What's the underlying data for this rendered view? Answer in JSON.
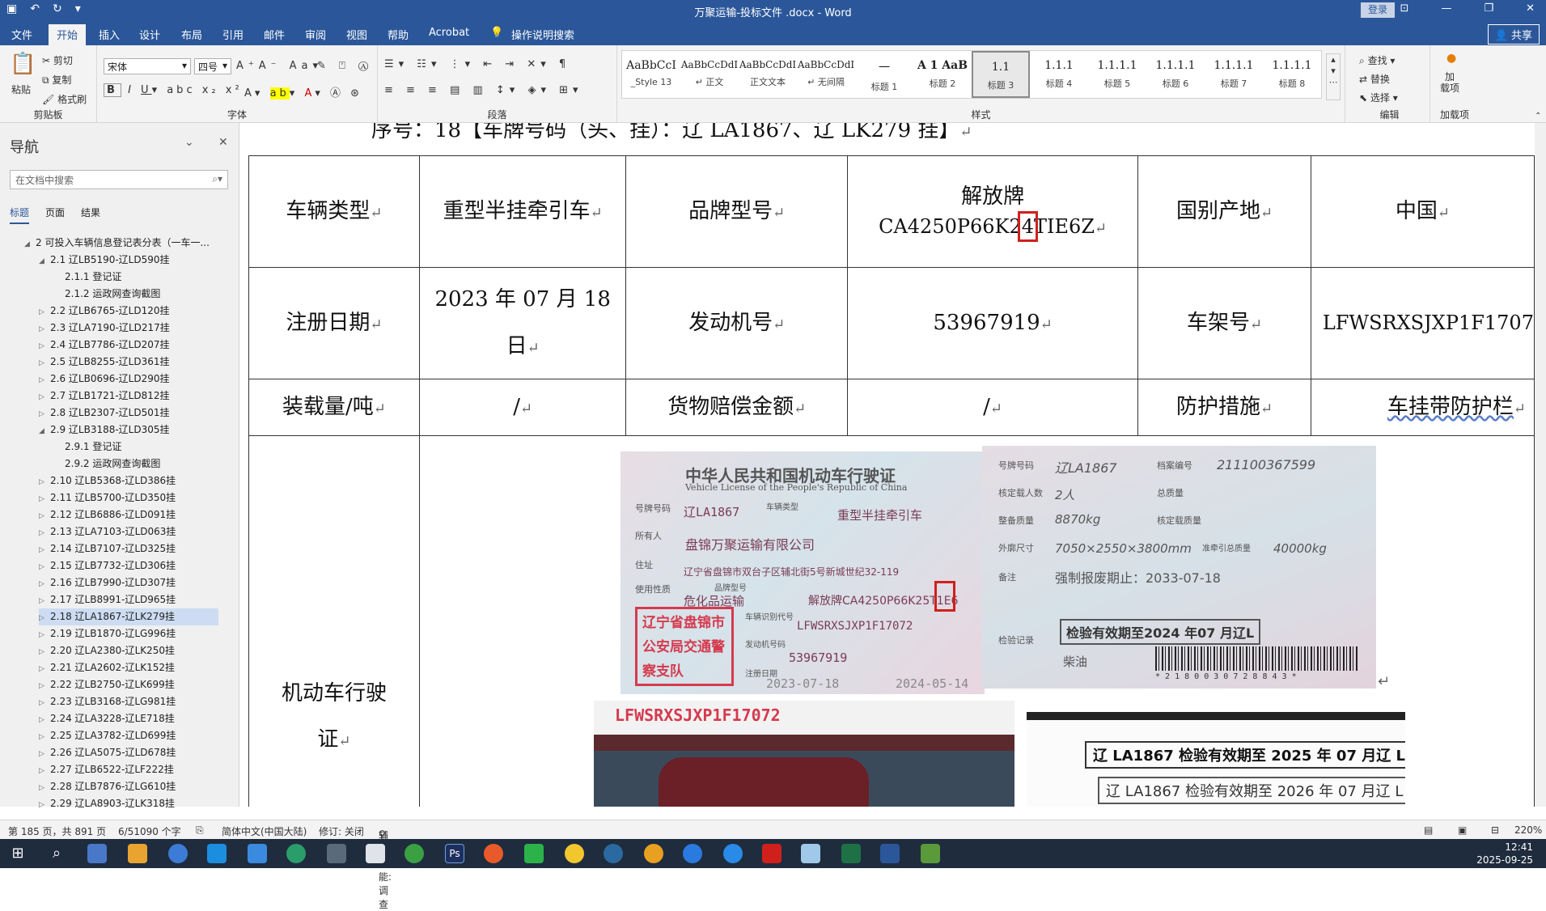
{
  "window": {
    "title": "万聚运输-投标文件 .docx  -  Word",
    "login": "登录",
    "share": "共享"
  },
  "tabs": [
    {
      "label": "文件"
    },
    {
      "label": "开始"
    },
    {
      "label": "插入"
    },
    {
      "label": "设计"
    },
    {
      "label": "布局"
    },
    {
      "label": "引用"
    },
    {
      "label": "邮件"
    },
    {
      "label": "审阅"
    },
    {
      "label": "视图"
    },
    {
      "label": "帮助"
    },
    {
      "label": "Acrobat"
    },
    {
      "label": "操作说明搜索"
    }
  ],
  "ribbon": {
    "clipboard": {
      "paste": "粘贴",
      "cut": "剪切",
      "copy": "复制",
      "format_painter": "格式刷",
      "label": "剪贴板"
    },
    "font": {
      "family": "宋体",
      "size": "四号",
      "label": "字体"
    },
    "paragraph": {
      "label": "段落"
    },
    "styles": {
      "label": "样式",
      "items": [
        {
          "preview": "AaBbCcI",
          "name": "_Style 13"
        },
        {
          "preview": "AaBbCcDdI",
          "name": "↵ 正文"
        },
        {
          "preview": "AaBbCcDdI",
          "name": "正文文本"
        },
        {
          "preview": "AaBbCcDdI",
          "name": "↵ 无间隔"
        },
        {
          "preview": "一",
          "name": "标题 1"
        },
        {
          "preview": "A 1 AaB",
          "name": "标题 2"
        },
        {
          "preview": "1.1 ",
          "name": "标题 3"
        },
        {
          "preview": "1.1.1",
          "name": "标题 4"
        },
        {
          "preview": "1.1.1.1",
          "name": "标题 5"
        },
        {
          "preview": "1.1.1.1",
          "name": "标题 6"
        },
        {
          "preview": "1.1.1.1",
          "name": "标题 7"
        },
        {
          "preview": "1.1.1.1",
          "name": "标题 8"
        }
      ]
    },
    "editing": {
      "find": "查找",
      "replace": "替换",
      "select": "选择",
      "label": "编辑"
    },
    "addins": {
      "button": "加\n载项",
      "label": "加载项"
    }
  },
  "nav": {
    "title": "导航",
    "search_placeholder": "在文档中搜索",
    "tabs": [
      "标题",
      "页面",
      "结果"
    ],
    "items": [
      {
        "text": "2 可投入车辆信息登记表分表（一车一...",
        "level": 0,
        "arrow": "◢"
      },
      {
        "text": "2.1 辽LB5190-辽LD590挂",
        "level": 1,
        "arrow": "◢"
      },
      {
        "text": "2.1.1 登记证",
        "level": 2,
        "arrow": ""
      },
      {
        "text": "2.1.2 运政网查询截图",
        "level": 2,
        "arrow": ""
      },
      {
        "text": "2.2 辽LB6765-辽LD120挂",
        "level": 1,
        "arrow": "▷"
      },
      {
        "text": "2.3 辽LA7190-辽LD217挂",
        "level": 1,
        "arrow": "▷"
      },
      {
        "text": "2.4 辽LB7786-辽LD207挂",
        "level": 1,
        "arrow": "▷"
      },
      {
        "text": "2.5 辽LB8255-辽LD361挂",
        "level": 1,
        "arrow": "▷"
      },
      {
        "text": "2.6 辽LB0696-辽LD290挂",
        "level": 1,
        "arrow": "▷"
      },
      {
        "text": "2.7 辽LB1721-辽LD812挂",
        "level": 1,
        "arrow": "▷"
      },
      {
        "text": "2.8 辽LB2307-辽LD501挂",
        "level": 1,
        "arrow": "▷"
      },
      {
        "text": "2.9 辽LB3188-辽LD305挂",
        "level": 1,
        "arrow": "◢"
      },
      {
        "text": "2.9.1 登记证",
        "level": 2,
        "arrow": ""
      },
      {
        "text": "2.9.2 运政网查询截图",
        "level": 2,
        "arrow": ""
      },
      {
        "text": "2.10 辽LB5368-辽LD386挂",
        "level": 1,
        "arrow": "▷"
      },
      {
        "text": "2.11 辽LB5700-辽LD350挂",
        "level": 1,
        "arrow": "▷"
      },
      {
        "text": "2.12 辽LB6886-辽LD091挂",
        "level": 1,
        "arrow": "▷"
      },
      {
        "text": "2.13 辽LA7103-辽LD063挂",
        "level": 1,
        "arrow": "▷"
      },
      {
        "text": "2.14 辽LB7107-辽LD325挂",
        "level": 1,
        "arrow": "▷"
      },
      {
        "text": "2.15 辽LB7732-辽LD306挂",
        "level": 1,
        "arrow": "▷"
      },
      {
        "text": "2.16 辽LB7990-辽LD307挂",
        "level": 1,
        "arrow": "▷"
      },
      {
        "text": "2.17 辽LB8991-辽LD965挂",
        "level": 1,
        "arrow": "▷"
      },
      {
        "text": "2.18 辽LA1867-辽LK279挂",
        "level": 1,
        "arrow": "▷",
        "selected": true
      },
      {
        "text": "2.19 辽LB1870-辽LG996挂",
        "level": 1,
        "arrow": "▷"
      },
      {
        "text": "2.20 辽LA2380-辽LK250挂",
        "level": 1,
        "arrow": "▷"
      },
      {
        "text": "2.21 辽LA2602-辽LK152挂",
        "level": 1,
        "arrow": "▷"
      },
      {
        "text": "2.22 辽LB2750-辽LK699挂",
        "level": 1,
        "arrow": "▷"
      },
      {
        "text": "2.23 辽LB3168-辽LG981挂",
        "level": 1,
        "arrow": "▷"
      },
      {
        "text": "2.24 辽LA3228-辽LE718挂",
        "level": 1,
        "arrow": "▷"
      },
      {
        "text": "2.25 辽LA3782-辽LD699挂",
        "level": 1,
        "arrow": "▷"
      },
      {
        "text": "2.26 辽LA5075-辽LD678挂",
        "level": 1,
        "arrow": "▷"
      },
      {
        "text": "2.27 辽LB6522-辽LF222挂",
        "level": 1,
        "arrow": "▷"
      },
      {
        "text": "2.28 辽LB7876-辽LG610挂",
        "level": 1,
        "arrow": "▷"
      },
      {
        "text": "2.29 辽LA8903-辽LK318挂",
        "level": 1,
        "arrow": "▷"
      }
    ]
  },
  "doc": {
    "heading_partial": "序号：18【车牌号码（头、挂）：辽 LA1867、辽 LK279 挂】",
    "table": {
      "r1": [
        "车辆类型",
        "重型半挂牵引车",
        "品牌型号",
        "解放牌",
        "CA4250P66K2",
        "4",
        "T",
        "IE6Z",
        "国别产地",
        "中国"
      ],
      "r2": [
        "注册日期",
        "2023 年 07 月 18",
        "日",
        "发动机号",
        "53967919",
        "车架号",
        "LFWSRXSJXP1F1707"
      ],
      "r3": [
        "装载量/吨",
        "/",
        "货物赔偿金额",
        "/",
        "防护措施",
        "车挂带防护栏"
      ],
      "r4_label": [
        "机动车行驶",
        "证"
      ]
    },
    "license": {
      "title": "中华人民共和国机动车行驶证",
      "subtitle": "Vehicle License of the People's Republic of China",
      "plate_label": "号牌号码",
      "plate": "辽LA1867",
      "type_label": "车辆类型",
      "type": "重型半挂牵引车",
      "owner_label": "所有人",
      "owner": "盘锦万聚运输有限公司",
      "address_label": "住址",
      "address": "辽宁省盘锦市双台子区辅北街5号新城世纪32-119",
      "use_label": "使用性质",
      "use": "危化品运输",
      "model_label": "品牌型号",
      "model": "解放牌CA4250P66K25T1E6",
      "vin_label": "车辆识别代号",
      "vin": "LFWSRXSJXP1F17072",
      "engine_label": "发动机号码",
      "engine": "53967919",
      "reg_label": "注册日期",
      "reg": "2023-07-18",
      "issue": "2024-05-14",
      "stamp": "辽宁省盘锦市公安局交通警察支队"
    },
    "license_back": {
      "plate_label": "号牌号码",
      "plate": "辽LA1867",
      "file_label": "档案编号",
      "file_no": "211100367599",
      "seats_label": "核定载人数",
      "seats": "2人",
      "total_label": "总质量",
      "curb_label": "整备质量",
      "curb": "8870kg",
      "load_label": "核定载质量",
      "dims_label": "外廓尺寸",
      "dims": "7050×2550×3800mm",
      "tow_label": "准牵引总质量",
      "tow": "40000kg",
      "note_label": "备注",
      "note": "强制报废期止：2033-07-18",
      "inspect_label": "检验记录",
      "inspect": "检验有效期至2024 年07 月辽L",
      "fuel": "柴油",
      "barcode": "* 2 1 8 0 0 3 0 7 2 8 8 4 3 *"
    },
    "photo_vin": "LFWSRXSJXP1F17072",
    "stamp1": "辽 LA1867 检验有效期至 2025 年 07 月辽 L",
    "stamp2": "辽 LA1867 检验有效期至 2026 年 07 月辽 L"
  },
  "status": {
    "page": "第 185 页，共 891 页",
    "words": "6/51090 个字",
    "lang": "简体中文(中国大陆)",
    "track": "修订: 关闭",
    "access": "辅助功能: 调查",
    "zoom": "220%"
  },
  "taskbar": {
    "time": "12:41",
    "date": "2025-09-25"
  },
  "colors": {
    "accent": "#2b579a",
    "highlight": "#d0201b"
  }
}
